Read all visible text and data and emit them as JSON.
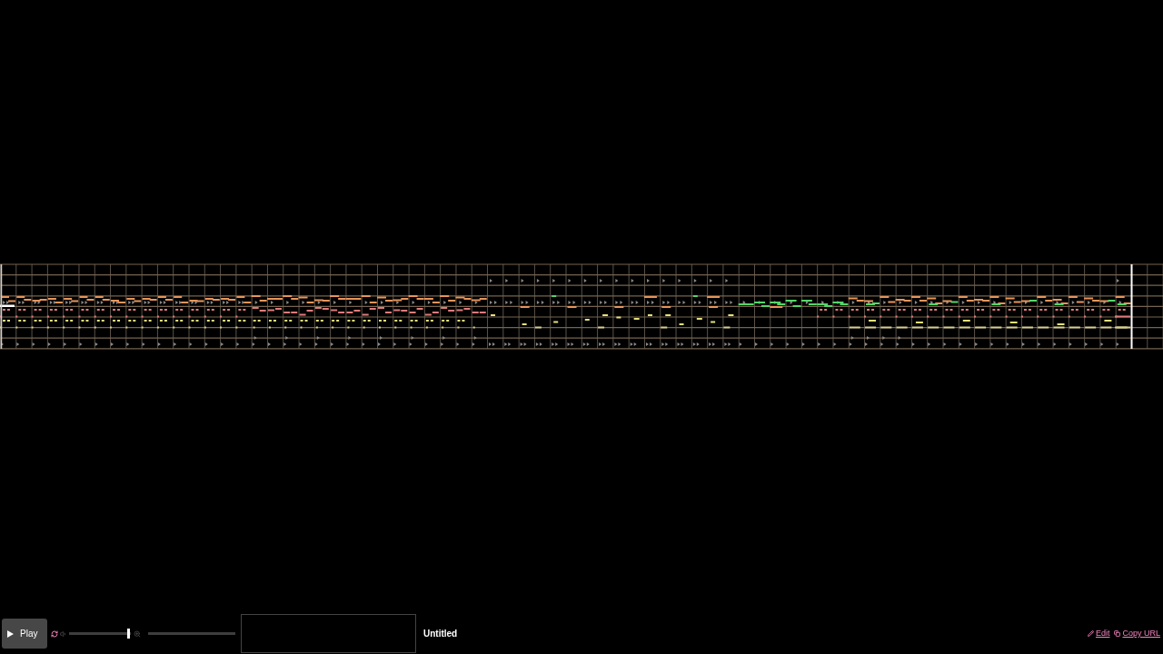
{
  "player": {
    "play_button": {
      "label": "Play"
    },
    "loop_button": {
      "on": true
    },
    "volume": {
      "level": 0.95
    },
    "song_title": "Untitled"
  },
  "links": [
    {
      "kind": "edit",
      "label": "Edit"
    },
    {
      "kind": "copy",
      "label": "Copy URL"
    }
  ]
}
